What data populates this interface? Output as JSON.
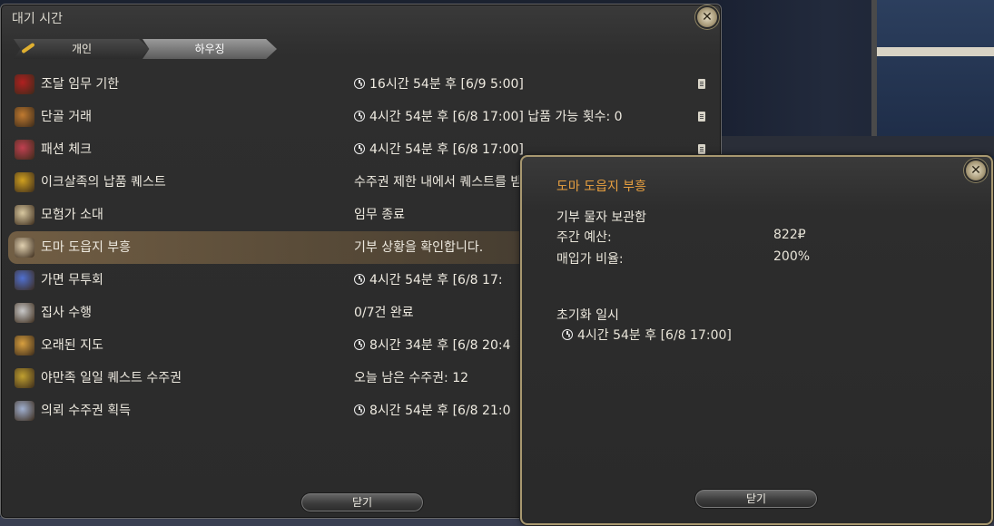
{
  "window": {
    "title": "대기 시간",
    "close_label": "✕",
    "tabs": [
      {
        "label": "개인"
      },
      {
        "label": "하우징"
      }
    ],
    "rows": [
      {
        "name": "조달 임무 기한",
        "value": "16시간 54분 후 [6/9 5:00]",
        "clock": true,
        "memo": true,
        "icon": "supply-mission-icon",
        "icon_color": "#b02020"
      },
      {
        "name": "단골 거래",
        "value": "4시간 54분 후 [6/8 17:00] 납품 가능 횟수: 0",
        "clock": true,
        "memo": true,
        "icon": "custom-delivery-icon",
        "icon_color": "#c07a30"
      },
      {
        "name": "패션 체크",
        "value": "4시간 54분 후 [6/8 17:00]",
        "clock": true,
        "memo": true,
        "icon": "rose-icon",
        "icon_color": "#c04050"
      },
      {
        "name": "이크살족의 납품 퀘스트",
        "value": "수주권 제한 내에서 퀘스트를 받",
        "clock": false,
        "memo": false,
        "icon": "ixal-icon",
        "icon_color": "#d0a020"
      },
      {
        "name": "모험가 소대",
        "value": "임무 종료",
        "clock": false,
        "memo": false,
        "icon": "squadron-icon",
        "icon_color": "#d8c8a0"
      },
      {
        "name": "도마 도읍지 부흥",
        "value": "기부 상황을 확인합니다.",
        "clock": false,
        "memo": false,
        "icon": "doman-scroll-icon",
        "icon_color": "#e0d0b0"
      },
      {
        "name": "가면 무투회",
        "value": "4시간 54분 후   [6/8 17:",
        "clock": true,
        "memo": false,
        "icon": "masked-carnivale-icon",
        "icon_color": "#5070d0"
      },
      {
        "name": "집사 수행",
        "value": "0/7건 완료",
        "clock": false,
        "memo": false,
        "icon": "bell-icon",
        "icon_color": "#c8c8c8"
      },
      {
        "name": "오래된 지도",
        "value": "8시간 34분 후 [6/8 20:4",
        "clock": true,
        "memo": false,
        "icon": "treasure-map-icon",
        "icon_color": "#d8a040"
      },
      {
        "name": "야만족 일일 퀘스트 수주권",
        "value": "오늘 남은 수주권: 12",
        "clock": false,
        "memo": false,
        "icon": "beast-tribe-icon",
        "icon_color": "#c0a030"
      },
      {
        "name": "의뢰 수주권 획득",
        "value": "8시간 54분 후 [6/8 21:0",
        "clock": true,
        "memo": false,
        "icon": "allowance-icon",
        "icon_color": "#a0b0d0"
      }
    ],
    "close_button": "닫기"
  },
  "detail": {
    "title": "도마 도읍지 부흥",
    "section1": "기부 물자 보관함",
    "budget_label": "주간 예산:",
    "budget_value": "822₽",
    "rate_label": "매입가 비율:",
    "rate_value": "200%",
    "section2": "초기화 일시",
    "reset_time": "4시간 54분 후 [6/8 17:00]",
    "close_button": "닫기",
    "close_label": "✕"
  },
  "colors": {
    "accent_title": "#e8a040",
    "selected_row": "#96784f",
    "popup_border": "#a89870"
  }
}
